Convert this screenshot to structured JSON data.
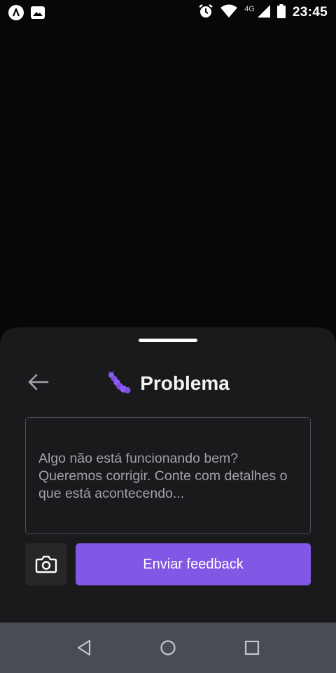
{
  "status_bar": {
    "time": "23:45",
    "network_type": "4G",
    "icons": [
      "app-icon",
      "image-icon",
      "alarm-icon",
      "wifi-icon",
      "signal-icon",
      "battery-icon"
    ]
  },
  "feedback": {
    "title": "Problema",
    "title_icon": "caterpillar-icon",
    "textarea_placeholder": "Algo não está funcionando bem? Queremos corrigir. Conte com detalhes o que está acontecendo...",
    "submit_label": "Enviar feedback",
    "back_icon": "arrow-left-icon",
    "screenshot_icon": "camera-icon"
  },
  "nav_bar": {
    "icons": [
      "back-triangle-icon",
      "home-circle-icon",
      "recents-square-icon"
    ]
  },
  "colors": {
    "background": "#070707",
    "sheet": "#1a1a1d",
    "accent": "#8257e5",
    "nav_bar": "#474c55"
  }
}
